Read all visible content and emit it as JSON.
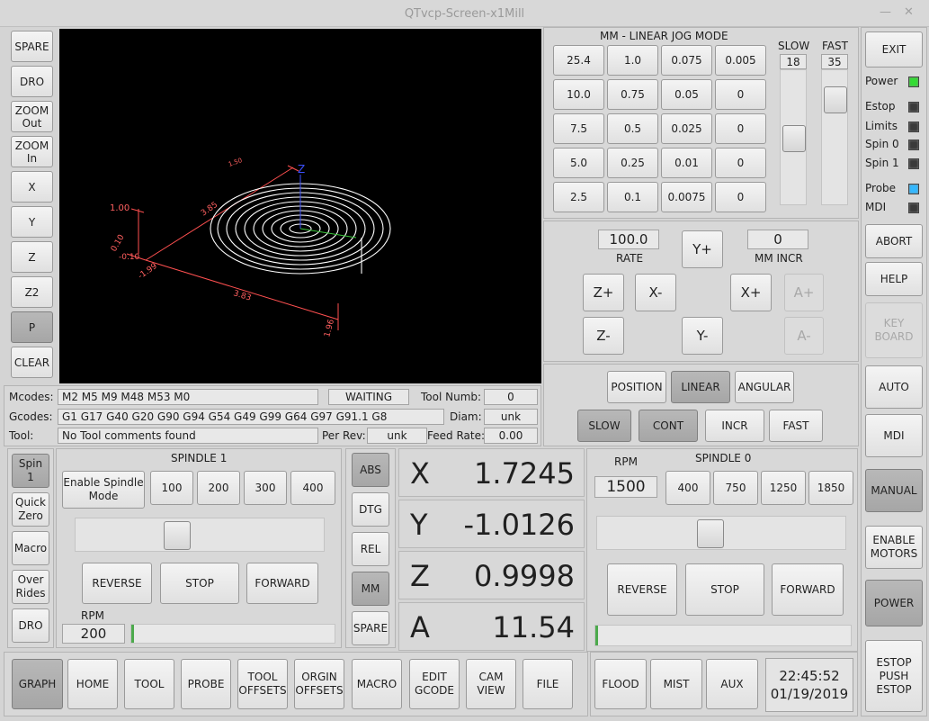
{
  "window": {
    "title": "QTvcp-Screen-x1Mill",
    "minimize": "—",
    "close": "✕"
  },
  "left_buttons": [
    "SPARE",
    "DRO",
    "ZOOM\nOut",
    "ZOOM\nIn",
    "X",
    "Y",
    "Z",
    "Z2",
    "P",
    "CLEAR"
  ],
  "graph": {
    "axis_z": "Z",
    "labels": [
      "1.00",
      "0.10",
      "-0.10",
      "-1.99",
      "3.83",
      "1.96",
      "1.96",
      "3.85",
      "1.50"
    ],
    "colors": {
      "bg": "#000000",
      "toolpath": "#ffffff",
      "dims": "#ff4444",
      "axis": "#3c50ff",
      "feed": "#3cc83c"
    }
  },
  "status": {
    "mcodes_label": "Mcodes:",
    "mcodes": "M2 M5 M9 M48 M53 M0",
    "state": "WAITING",
    "toolnum_label": "Tool Numb:",
    "toolnum": "0",
    "gcodes_label": "Gcodes:",
    "gcodes": "G1 G17 G40 G20 G90 G94 G54 G49 G99 G64 G97 G91.1 G8",
    "diam_label": "Diam:",
    "diam": "unk",
    "tool_label": "Tool:",
    "tool": "No Tool comments found",
    "perrev_label": "Per Rev:",
    "perrev": "unk",
    "feedrate_label": "Feed Rate:",
    "feedrate": "0.00"
  },
  "jog": {
    "title": "MM - LINEAR JOG MODE",
    "grid": [
      [
        "25.4",
        "1.0",
        "0.075",
        "0.005"
      ],
      [
        "10.0",
        "0.75",
        "0.05",
        "0"
      ],
      [
        "7.5",
        "0.5",
        "0.025",
        "0"
      ],
      [
        "5.0",
        "0.25",
        "0.01",
        "0"
      ],
      [
        "2.5",
        "0.1",
        "0.0075",
        "0"
      ]
    ],
    "slow_label": "SLOW",
    "slow_value": "18",
    "fast_label": "FAST",
    "fast_value": "35",
    "slow_level": 0.5,
    "fast_level": 0.15,
    "rate": "100.0",
    "rate_label": "RATE",
    "incr": "0",
    "incr_label": "MM INCR",
    "buttons": {
      "yplus": "Y+",
      "zplus": "Z+",
      "xminus": "X-",
      "xplus": "X+",
      "aplus": "A+",
      "zminus": "Z-",
      "yminus": "Y-",
      "aminus": "A-"
    },
    "modes": [
      "POSITION",
      "LINEAR",
      "ANGULAR"
    ],
    "speeds": [
      "SLOW",
      "CONT",
      "INCR",
      "FAST"
    ]
  },
  "right_panel": {
    "exit": "EXIT",
    "leds": [
      {
        "label": "Power",
        "color": "#33dd33"
      },
      {
        "label": "Estop",
        "color": "#3a3a3a"
      },
      {
        "label": "Limits",
        "color": "#3a3a3a"
      },
      {
        "label": "Spin 0",
        "color": "#3a3a3a"
      },
      {
        "label": "Spin 1",
        "color": "#3a3a3a"
      },
      {
        "label": "Probe",
        "color": "#33b8ff"
      },
      {
        "label": "MDI",
        "color": "#3a3a3a"
      }
    ],
    "buttons": [
      "ABORT",
      "HELP",
      "KEY\nBOARD",
      "AUTO",
      "MDI",
      "MANUAL",
      "ENABLE\nMOTORS",
      "POWER",
      "ESTOP\nPUSH\nESTOP"
    ]
  },
  "spindle1": {
    "side_buttons": [
      "Spin\n1",
      "Quick\nZero",
      "Macro",
      "Over\nRides",
      "DRO"
    ],
    "title": "SPINDLE 1",
    "enable": "Enable Spindle\nMode",
    "presets": [
      "100",
      "200",
      "300",
      "400"
    ],
    "reverse": "REVERSE",
    "stop": "STOP",
    "forward": "FORWARD",
    "rpm_label": "RPM",
    "rpm": "200",
    "slider_level": 0.4,
    "bar_level": 0.01
  },
  "dro_buttons": [
    "ABS",
    "DTG",
    "REL",
    "MM",
    "SPARE"
  ],
  "dro": [
    {
      "axis": "X",
      "value": "1.7245"
    },
    {
      "axis": "Y",
      "value": "-1.0126"
    },
    {
      "axis": "Z",
      "value": "0.9998"
    },
    {
      "axis": "A",
      "value": "11.54"
    }
  ],
  "spindle0": {
    "rpm_label": "RPM",
    "rpm": "1500",
    "title": "SPINDLE 0",
    "presets": [
      "400",
      "750",
      "1250",
      "1850"
    ],
    "reverse": "REVERSE",
    "stop": "STOP",
    "forward": "FORWARD",
    "slider_level": 0.45,
    "bar_level": 0.01
  },
  "tabs": [
    "GRAPH",
    "HOME",
    "TOOL",
    "PROBE",
    "TOOL\nOFFSETS",
    "ORGIN\nOFFSETS",
    "MACRO",
    "EDIT\nGCODE",
    "CAM\nVIEW",
    "FILE"
  ],
  "coolant": [
    "FLOOD",
    "MIST",
    "AUX"
  ],
  "clock": {
    "time": "22:45:52",
    "date": "01/19/2019"
  }
}
